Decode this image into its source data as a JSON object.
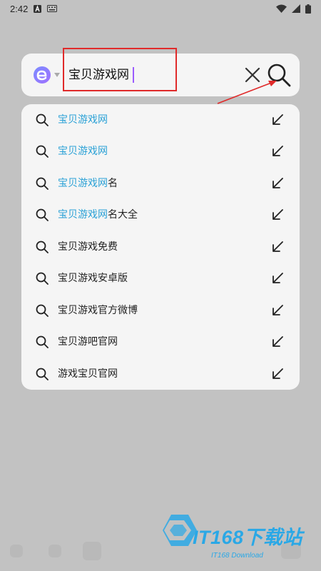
{
  "status_bar": {
    "time": "2:42",
    "icons": [
      "a-notification-icon",
      "keyboard-icon",
      "wifi-icon",
      "signal-icon",
      "battery-icon"
    ]
  },
  "search": {
    "engine_icon": "edge-browser-logo-icon",
    "query": "宝贝游戏网",
    "clear_icon": "close-icon",
    "submit_icon": "search-icon"
  },
  "suggestions": [
    {
      "match": "宝贝游戏网",
      "rest": ""
    },
    {
      "match": "宝贝游戏网",
      "rest": ""
    },
    {
      "match": "宝贝游戏网",
      "rest": "名"
    },
    {
      "match": "宝贝游戏网",
      "rest": "名大全"
    },
    {
      "match": "",
      "rest": "宝贝游戏免费"
    },
    {
      "match": "",
      "rest": "宝贝游戏安卓版"
    },
    {
      "match": "",
      "rest": "宝贝游戏官方微博"
    },
    {
      "match": "",
      "rest": "宝贝游吧官网"
    },
    {
      "match": "",
      "rest": "游戏宝贝官网"
    }
  ],
  "watermark": {
    "title": "IT168下载站",
    "subtitle": "IT168 Download"
  },
  "colors": {
    "background": "#c2c2c2",
    "panel": "#f5f5f5",
    "match_text": "#2aa1d6",
    "annotation": "#e02a2a",
    "cursor": "#9b5cff"
  }
}
